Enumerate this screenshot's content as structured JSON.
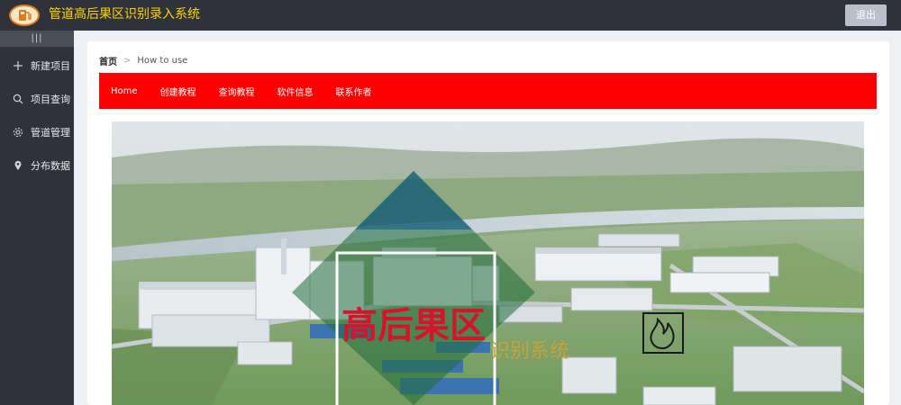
{
  "header": {
    "title": "管道高后果区识别录入系统",
    "logout_label": "退出",
    "logo_icon": "fuel-pump-icon"
  },
  "sidebar": {
    "collapse_icon": "|||",
    "items": [
      {
        "label": "新建项目",
        "icon": "plus-icon"
      },
      {
        "label": "项目查询",
        "icon": "search-icon"
      },
      {
        "label": "管道管理",
        "icon": "gear-icon"
      },
      {
        "label": "分布数据",
        "icon": "location-pin-icon"
      }
    ]
  },
  "breadcrumb": {
    "home": "首页",
    "separator": ">",
    "current": "How to use"
  },
  "nav": {
    "items": [
      "Home",
      "创建教程",
      "查询教程",
      "软件信息",
      "联系作者"
    ]
  },
  "banner": {
    "title": "高后果区",
    "subtitle": "识别系统",
    "icon": "flame-icon"
  },
  "colors": {
    "header_bg": "#2f323a",
    "title_yellow": "#ffd400",
    "nav_red": "#ff0000",
    "banner_title_red": "#d8122b",
    "banner_subtitle_gold": "#c8a23a"
  }
}
